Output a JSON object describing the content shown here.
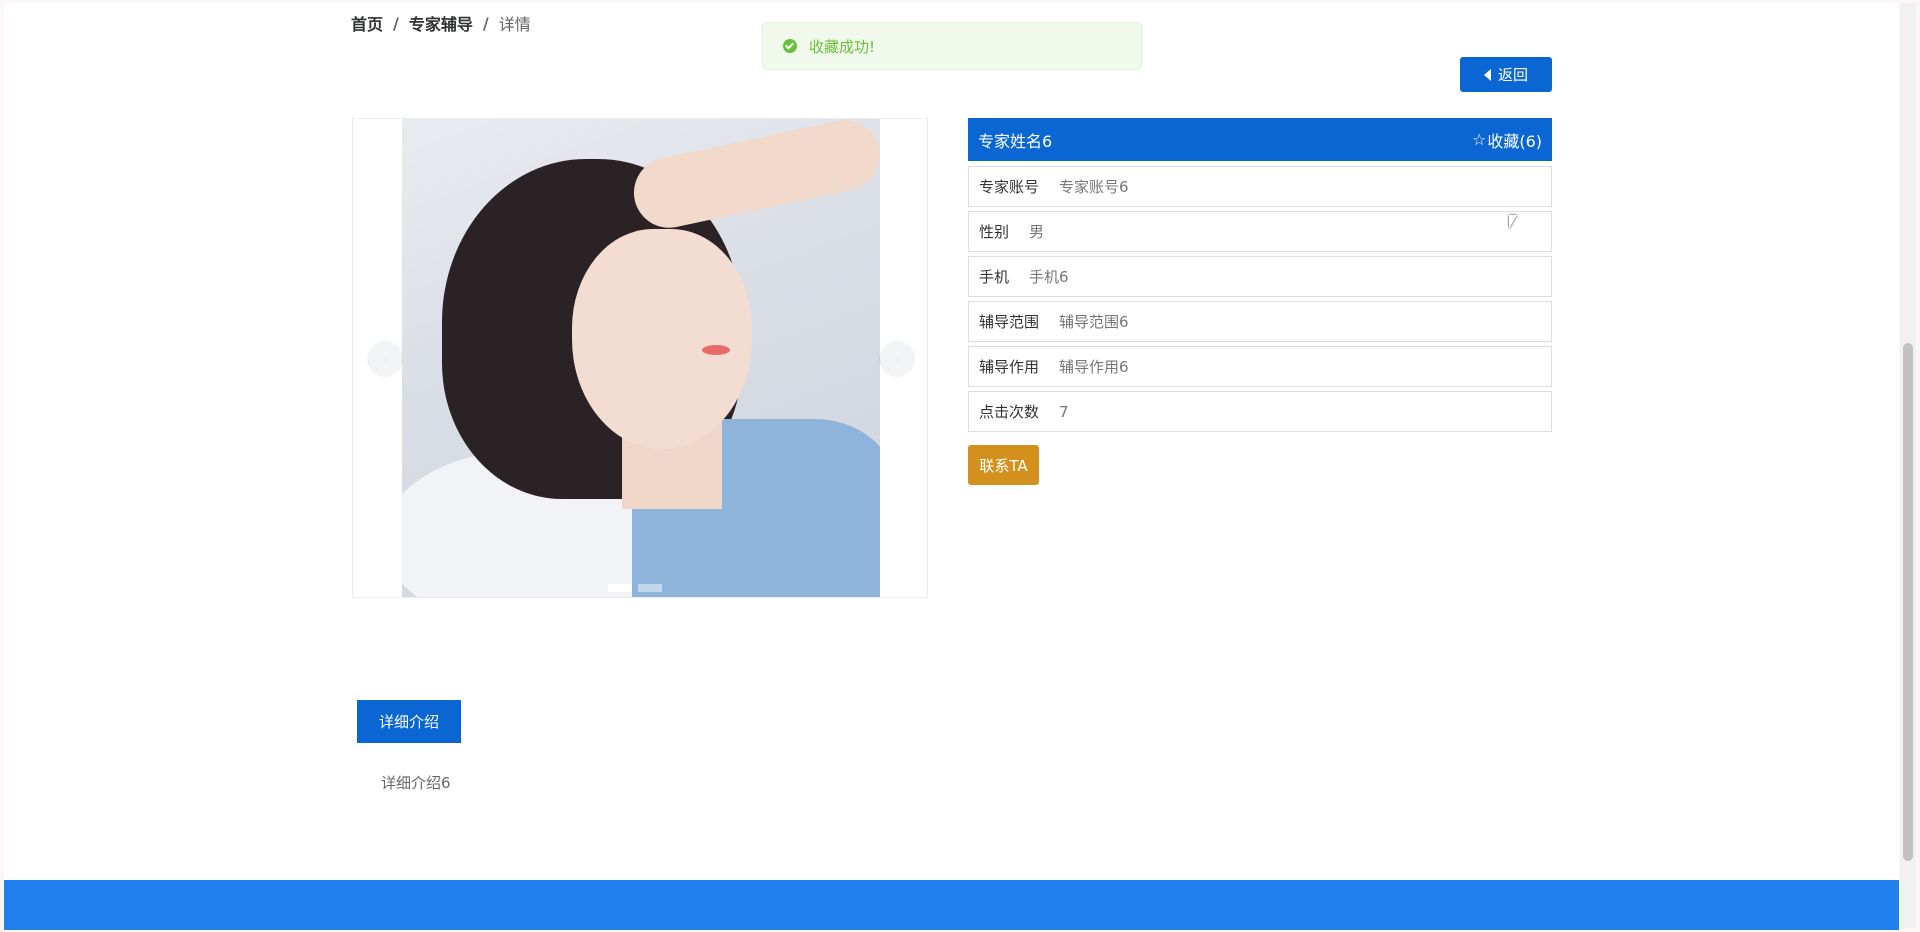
{
  "breadcrumb": {
    "home": "首页",
    "section": "专家辅导",
    "current": "详情",
    "separator": "/"
  },
  "toast": {
    "message": "收藏成功!",
    "icon": "check-circle-icon",
    "color": "#67c23a"
  },
  "back_button": {
    "label": "返回",
    "icon": "caret-left-icon"
  },
  "carousel": {
    "prev_icon": "chevron-left-icon",
    "next_icon": "chevron-right-icon",
    "prev_glyph": "‹",
    "next_glyph": "›",
    "slide_count": 2,
    "active_index": 0
  },
  "expert": {
    "name": "专家姓名6",
    "favorite_label": "收藏(6)",
    "favorite_icon": "star-outline-icon",
    "fields": [
      {
        "label": "专家账号",
        "value": "专家账号6"
      },
      {
        "label": "性别",
        "value": "男"
      },
      {
        "label": "手机",
        "value": "手机6"
      },
      {
        "label": "辅导范围",
        "value": "辅导范围6"
      },
      {
        "label": "辅导作用",
        "value": "辅导作用6"
      },
      {
        "label": "点击次数",
        "value": "7"
      }
    ],
    "contact_label": "联系TA"
  },
  "detail": {
    "tab_label": "详细介绍",
    "content": "详细介绍6"
  },
  "colors": {
    "primary": "#0a66d2",
    "footer": "#1f80ee",
    "contact": "#d4901c",
    "success": "#67c23a"
  }
}
